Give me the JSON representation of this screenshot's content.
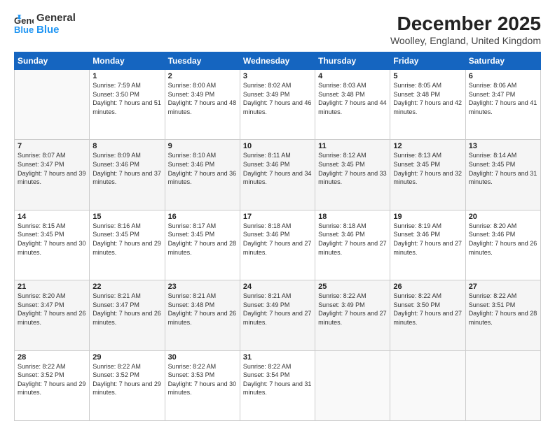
{
  "header": {
    "logo": {
      "line1": "General",
      "line2": "Blue"
    },
    "title": "December 2025",
    "subtitle": "Woolley, England, United Kingdom"
  },
  "calendar": {
    "days_of_week": [
      "Sunday",
      "Monday",
      "Tuesday",
      "Wednesday",
      "Thursday",
      "Friday",
      "Saturday"
    ],
    "weeks": [
      [
        {
          "day": "",
          "sunrise": "",
          "sunset": "",
          "daylight": ""
        },
        {
          "day": "1",
          "sunrise": "Sunrise: 7:59 AM",
          "sunset": "Sunset: 3:50 PM",
          "daylight": "Daylight: 7 hours and 51 minutes."
        },
        {
          "day": "2",
          "sunrise": "Sunrise: 8:00 AM",
          "sunset": "Sunset: 3:49 PM",
          "daylight": "Daylight: 7 hours and 48 minutes."
        },
        {
          "day": "3",
          "sunrise": "Sunrise: 8:02 AM",
          "sunset": "Sunset: 3:49 PM",
          "daylight": "Daylight: 7 hours and 46 minutes."
        },
        {
          "day": "4",
          "sunrise": "Sunrise: 8:03 AM",
          "sunset": "Sunset: 3:48 PM",
          "daylight": "Daylight: 7 hours and 44 minutes."
        },
        {
          "day": "5",
          "sunrise": "Sunrise: 8:05 AM",
          "sunset": "Sunset: 3:48 PM",
          "daylight": "Daylight: 7 hours and 42 minutes."
        },
        {
          "day": "6",
          "sunrise": "Sunrise: 8:06 AM",
          "sunset": "Sunset: 3:47 PM",
          "daylight": "Daylight: 7 hours and 41 minutes."
        }
      ],
      [
        {
          "day": "7",
          "sunrise": "Sunrise: 8:07 AM",
          "sunset": "Sunset: 3:47 PM",
          "daylight": "Daylight: 7 hours and 39 minutes."
        },
        {
          "day": "8",
          "sunrise": "Sunrise: 8:09 AM",
          "sunset": "Sunset: 3:46 PM",
          "daylight": "Daylight: 7 hours and 37 minutes."
        },
        {
          "day": "9",
          "sunrise": "Sunrise: 8:10 AM",
          "sunset": "Sunset: 3:46 PM",
          "daylight": "Daylight: 7 hours and 36 minutes."
        },
        {
          "day": "10",
          "sunrise": "Sunrise: 8:11 AM",
          "sunset": "Sunset: 3:46 PM",
          "daylight": "Daylight: 7 hours and 34 minutes."
        },
        {
          "day": "11",
          "sunrise": "Sunrise: 8:12 AM",
          "sunset": "Sunset: 3:45 PM",
          "daylight": "Daylight: 7 hours and 33 minutes."
        },
        {
          "day": "12",
          "sunrise": "Sunrise: 8:13 AM",
          "sunset": "Sunset: 3:45 PM",
          "daylight": "Daylight: 7 hours and 32 minutes."
        },
        {
          "day": "13",
          "sunrise": "Sunrise: 8:14 AM",
          "sunset": "Sunset: 3:45 PM",
          "daylight": "Daylight: 7 hours and 31 minutes."
        }
      ],
      [
        {
          "day": "14",
          "sunrise": "Sunrise: 8:15 AM",
          "sunset": "Sunset: 3:45 PM",
          "daylight": "Daylight: 7 hours and 30 minutes."
        },
        {
          "day": "15",
          "sunrise": "Sunrise: 8:16 AM",
          "sunset": "Sunset: 3:45 PM",
          "daylight": "Daylight: 7 hours and 29 minutes."
        },
        {
          "day": "16",
          "sunrise": "Sunrise: 8:17 AM",
          "sunset": "Sunset: 3:45 PM",
          "daylight": "Daylight: 7 hours and 28 minutes."
        },
        {
          "day": "17",
          "sunrise": "Sunrise: 8:18 AM",
          "sunset": "Sunset: 3:46 PM",
          "daylight": "Daylight: 7 hours and 27 minutes."
        },
        {
          "day": "18",
          "sunrise": "Sunrise: 8:18 AM",
          "sunset": "Sunset: 3:46 PM",
          "daylight": "Daylight: 7 hours and 27 minutes."
        },
        {
          "day": "19",
          "sunrise": "Sunrise: 8:19 AM",
          "sunset": "Sunset: 3:46 PM",
          "daylight": "Daylight: 7 hours and 27 minutes."
        },
        {
          "day": "20",
          "sunrise": "Sunrise: 8:20 AM",
          "sunset": "Sunset: 3:46 PM",
          "daylight": "Daylight: 7 hours and 26 minutes."
        }
      ],
      [
        {
          "day": "21",
          "sunrise": "Sunrise: 8:20 AM",
          "sunset": "Sunset: 3:47 PM",
          "daylight": "Daylight: 7 hours and 26 minutes."
        },
        {
          "day": "22",
          "sunrise": "Sunrise: 8:21 AM",
          "sunset": "Sunset: 3:47 PM",
          "daylight": "Daylight: 7 hours and 26 minutes."
        },
        {
          "day": "23",
          "sunrise": "Sunrise: 8:21 AM",
          "sunset": "Sunset: 3:48 PM",
          "daylight": "Daylight: 7 hours and 26 minutes."
        },
        {
          "day": "24",
          "sunrise": "Sunrise: 8:21 AM",
          "sunset": "Sunset: 3:49 PM",
          "daylight": "Daylight: 7 hours and 27 minutes."
        },
        {
          "day": "25",
          "sunrise": "Sunrise: 8:22 AM",
          "sunset": "Sunset: 3:49 PM",
          "daylight": "Daylight: 7 hours and 27 minutes."
        },
        {
          "day": "26",
          "sunrise": "Sunrise: 8:22 AM",
          "sunset": "Sunset: 3:50 PM",
          "daylight": "Daylight: 7 hours and 27 minutes."
        },
        {
          "day": "27",
          "sunrise": "Sunrise: 8:22 AM",
          "sunset": "Sunset: 3:51 PM",
          "daylight": "Daylight: 7 hours and 28 minutes."
        }
      ],
      [
        {
          "day": "28",
          "sunrise": "Sunrise: 8:22 AM",
          "sunset": "Sunset: 3:52 PM",
          "daylight": "Daylight: 7 hours and 29 minutes."
        },
        {
          "day": "29",
          "sunrise": "Sunrise: 8:22 AM",
          "sunset": "Sunset: 3:52 PM",
          "daylight": "Daylight: 7 hours and 29 minutes."
        },
        {
          "day": "30",
          "sunrise": "Sunrise: 8:22 AM",
          "sunset": "Sunset: 3:53 PM",
          "daylight": "Daylight: 7 hours and 30 minutes."
        },
        {
          "day": "31",
          "sunrise": "Sunrise: 8:22 AM",
          "sunset": "Sunset: 3:54 PM",
          "daylight": "Daylight: 7 hours and 31 minutes."
        },
        {
          "day": "",
          "sunrise": "",
          "sunset": "",
          "daylight": ""
        },
        {
          "day": "",
          "sunrise": "",
          "sunset": "",
          "daylight": ""
        },
        {
          "day": "",
          "sunrise": "",
          "sunset": "",
          "daylight": ""
        }
      ]
    ]
  }
}
